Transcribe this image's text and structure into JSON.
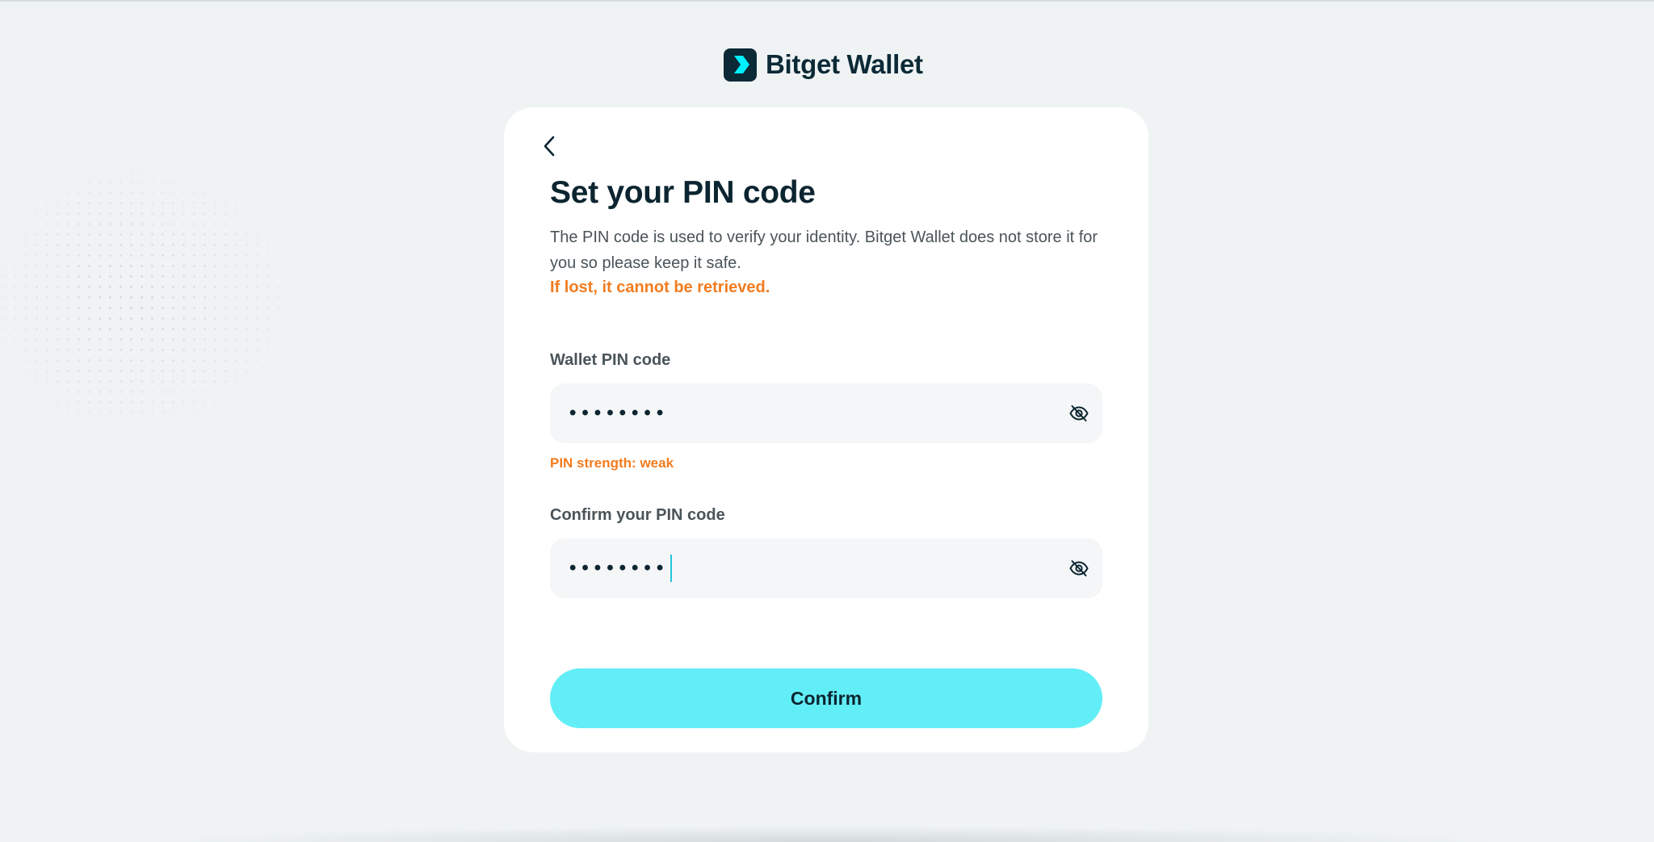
{
  "brand": {
    "name": "Bitget Wallet",
    "logo_icon": "bitget-chevron-logo",
    "logo_bg": "#0c2a36",
    "logo_accent": "#00f0ff"
  },
  "card": {
    "back_icon": "chevron-left-icon",
    "title": "Set your PIN code",
    "description": "The PIN code is used to verify your identity. Bitget Wallet does not store it for you so please keep it safe.",
    "warning": "If lost, it cannot be retrieved.",
    "warning_color": "#f27c1f"
  },
  "pin_field": {
    "label": "Wallet PIN code",
    "value_masked": "••••••••",
    "toggle_icon": "eye-off-icon"
  },
  "strength": {
    "text": "PIN strength: weak",
    "color": "#f27c1f"
  },
  "confirm_field": {
    "label": "Confirm your PIN code",
    "value_masked": "••••••••",
    "toggle_icon": "eye-off-icon"
  },
  "confirm_button": {
    "label": "Confirm",
    "color": "#62eef7"
  }
}
